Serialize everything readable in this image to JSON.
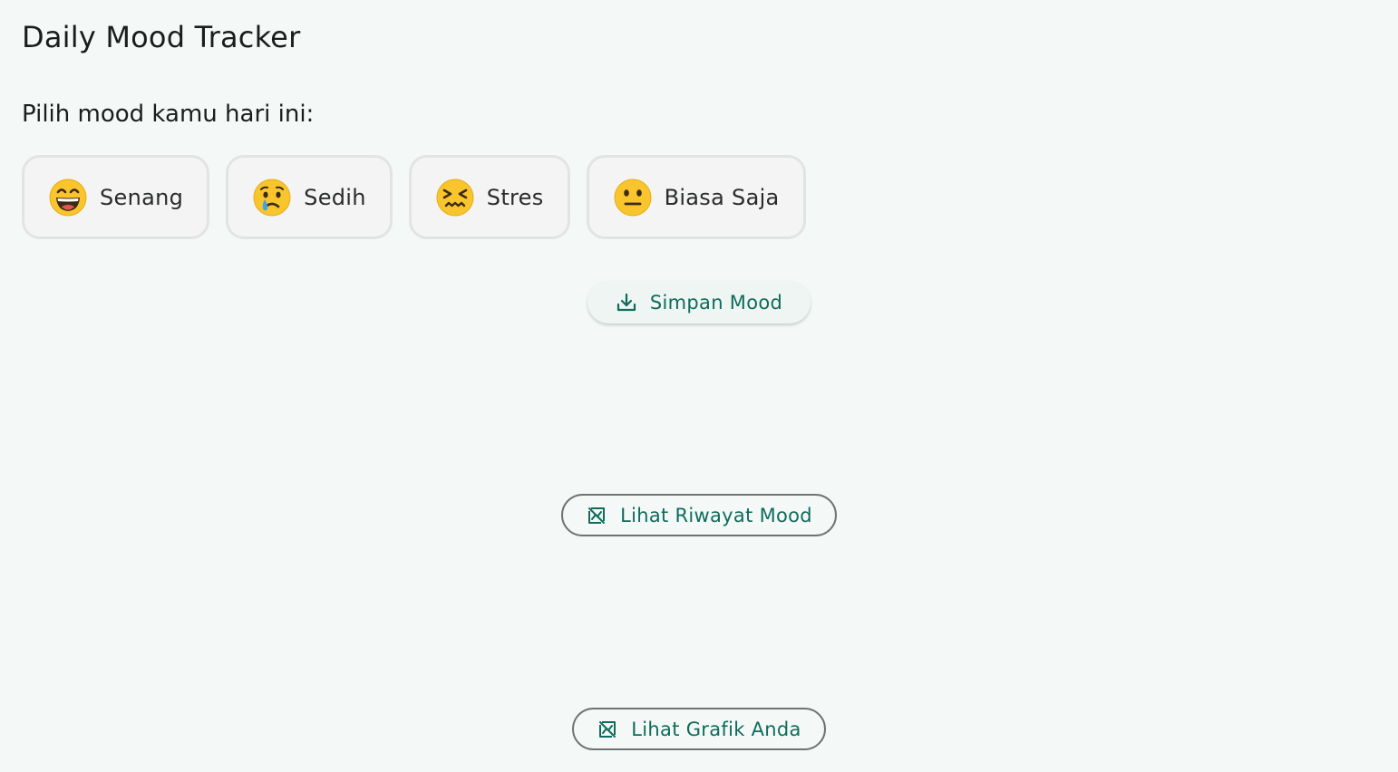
{
  "app": {
    "title": "Daily Mood Tracker"
  },
  "prompt": {
    "text": "Pilih mood kamu hari ini:"
  },
  "moods": [
    {
      "label": "Senang",
      "icon": "grinning-face-icon"
    },
    {
      "label": "Sedih",
      "icon": "crying-face-icon"
    },
    {
      "label": "Stres",
      "icon": "confounded-face-icon"
    },
    {
      "label": "Biasa Saja",
      "icon": "neutral-face-icon"
    }
  ],
  "actions": {
    "save_label": "Simpan Mood",
    "save_icon": "download-icon",
    "history_label": "Lihat Riwayat Mood",
    "history_icon": "chart-off-icon",
    "chart_label": "Lihat Grafik Anda",
    "chart_icon": "chart-off-icon"
  },
  "colors": {
    "background": "#f4f9f7",
    "accent": "#0f6b5c",
    "chip_background": "#f3f4f3",
    "chip_border": "#e2e4e3",
    "outline": "#6f7472",
    "emoji_yellow": "#f8c52c"
  }
}
